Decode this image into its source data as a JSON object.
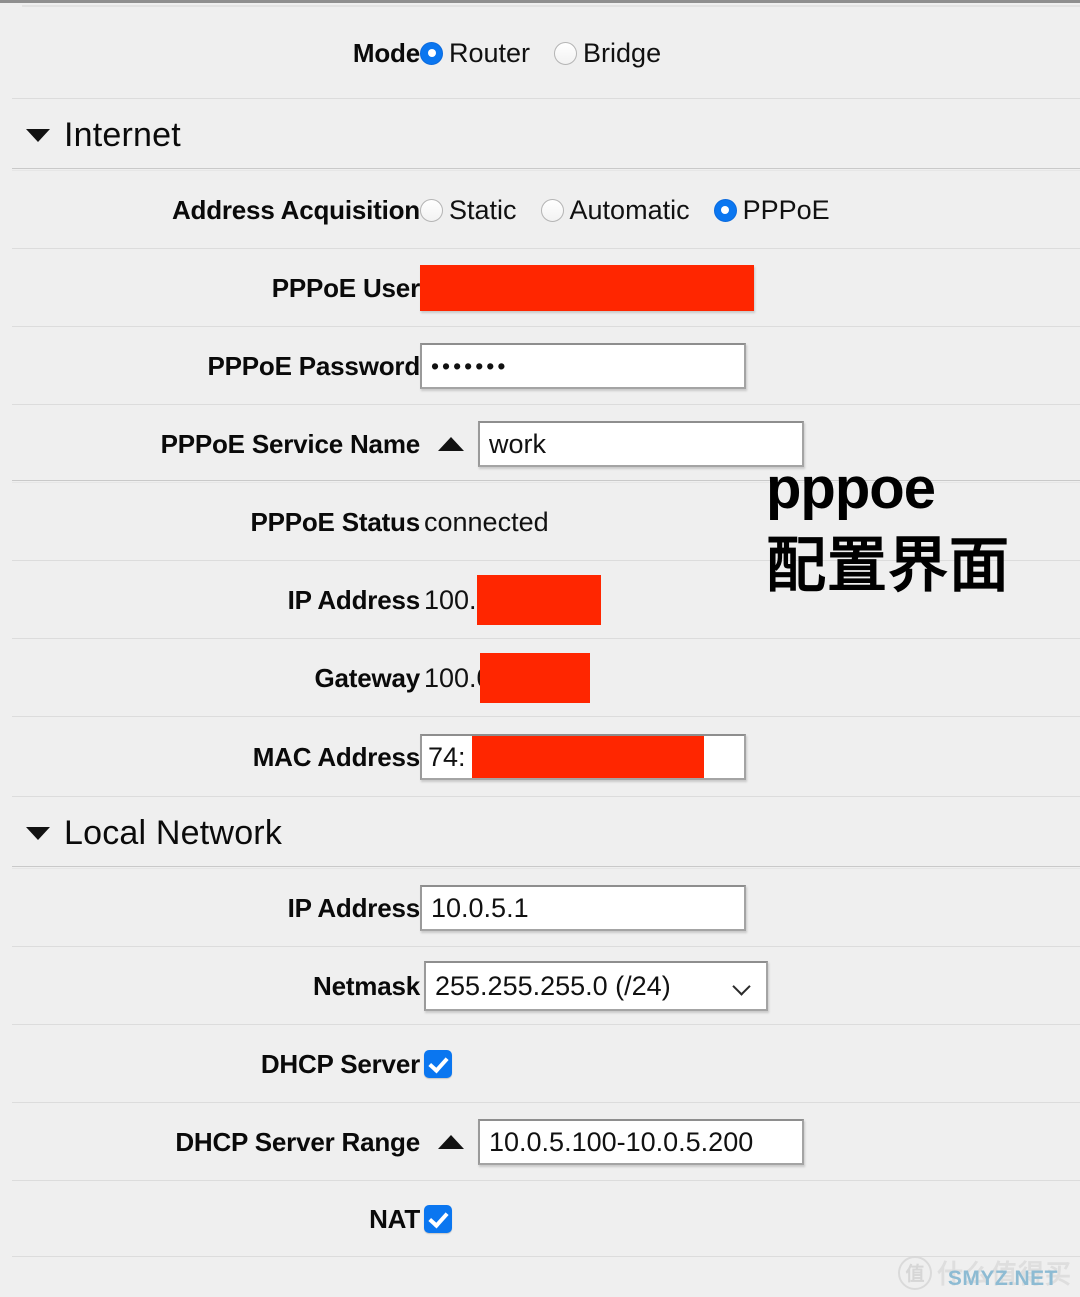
{
  "rows": {
    "mode": {
      "label": "Mode",
      "options": [
        {
          "label": "Router",
          "selected": true
        },
        {
          "label": "Bridge",
          "selected": false
        }
      ]
    },
    "internet_section": {
      "title": "Internet"
    },
    "address_acquisition": {
      "label": "Address Acquisition",
      "options": [
        {
          "label": "Static",
          "selected": false
        },
        {
          "label": "Automatic",
          "selected": false
        },
        {
          "label": "PPPoE",
          "selected": true
        }
      ]
    },
    "pppoe_user": {
      "label": "PPPoE User",
      "value": ""
    },
    "pppoe_password": {
      "label": "PPPoE Password",
      "value": "•••••••"
    },
    "pppoe_service_name": {
      "label": "PPPoE Service Name",
      "value": "work"
    },
    "pppoe_status": {
      "label": "PPPoE Status",
      "value": "connected"
    },
    "wan_ip_address": {
      "label": "IP Address",
      "value": "100."
    },
    "gateway": {
      "label": "Gateway",
      "value": "100.0"
    },
    "mac_address": {
      "label": "MAC Address",
      "value": "74:"
    },
    "local_section": {
      "title": "Local Network"
    },
    "lan_ip_address": {
      "label": "IP Address",
      "value": "10.0.5.1"
    },
    "netmask": {
      "label": "Netmask",
      "value": "255.255.255.0 (/24)"
    },
    "dhcp_server": {
      "label": "DHCP Server",
      "checked": true
    },
    "dhcp_server_range": {
      "label": "DHCP Server Range",
      "value": "10.0.5.100-10.0.5.200"
    },
    "nat": {
      "label": "NAT",
      "checked": true
    }
  },
  "annotation": {
    "line1": "pppoe",
    "line2": "配置界面"
  },
  "watermark": {
    "badge": "值",
    "text": "什么值得买",
    "site": "SMYZ.NET"
  },
  "colors": {
    "redaction": "#ff2600",
    "accent": "#0a76f0",
    "panel_bg": "#efefef"
  }
}
